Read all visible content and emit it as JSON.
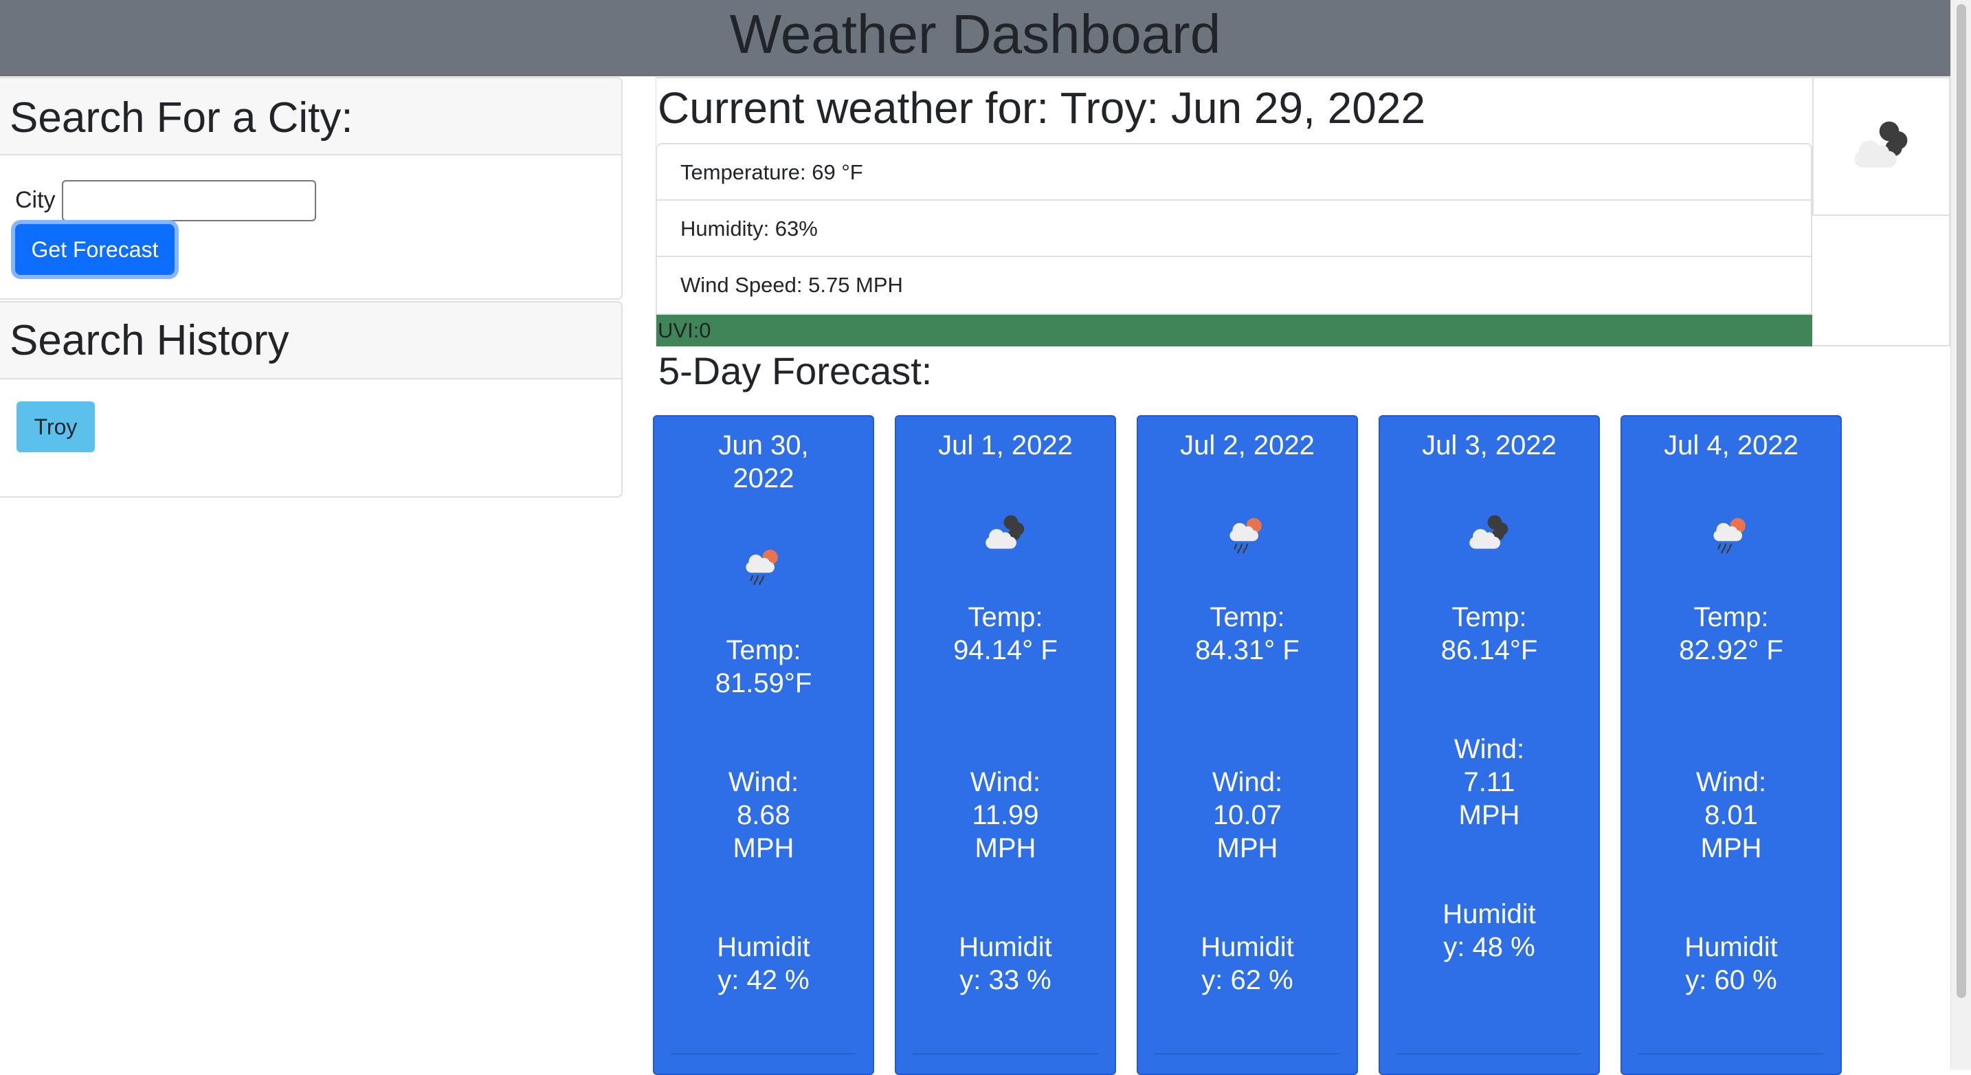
{
  "header": {
    "title": "Weather Dashboard"
  },
  "search": {
    "heading": "Search For a City:",
    "city_label": "City",
    "city_value": "",
    "button_label": "Get Forecast"
  },
  "history": {
    "heading": "Search History",
    "items": [
      {
        "label": "Troy"
      }
    ]
  },
  "current": {
    "title": "Current weather for: Troy: Jun 29, 2022",
    "icon": "broken-clouds-icon",
    "temperature": "Temperature: 69 °F",
    "humidity": "Humidity: 63%",
    "wind": "Wind Speed: 5.75 MPH",
    "uvi": "UVI:0",
    "uvi_color": "#408558"
  },
  "forecast": {
    "heading": "5-Day Forecast:",
    "card_color": "#2e6fe8",
    "days": [
      {
        "date": "Jun 30, 2022",
        "icon": "rain-sun-icon",
        "temp": "Temp: 81.59°F",
        "wind": "Wind: 8.68 MPH",
        "humidity": "Humidity: 42 %"
      },
      {
        "date": "Jul 1, 2022",
        "icon": "broken-clouds-icon",
        "temp": "Temp: 94.14° F",
        "wind": "Wind: 11.99 MPH",
        "humidity": "Humidity: 33 %"
      },
      {
        "date": "Jul 2, 2022",
        "icon": "rain-sun-icon",
        "temp": "Temp: 84.31° F",
        "wind": "Wind: 10.07 MPH",
        "humidity": "Humidity: 62 %"
      },
      {
        "date": "Jul 3, 2022",
        "icon": "broken-clouds-icon",
        "temp": "Temp: 86.14°F",
        "wind": "Wind: 7.11 MPH",
        "humidity": "Humidity: 48 %"
      },
      {
        "date": "Jul 4, 2022",
        "icon": "rain-sun-icon",
        "temp": "Temp: 82.92° F",
        "wind": "Wind: 8.01 MPH",
        "humidity": "Humidity: 60 %"
      }
    ]
  }
}
